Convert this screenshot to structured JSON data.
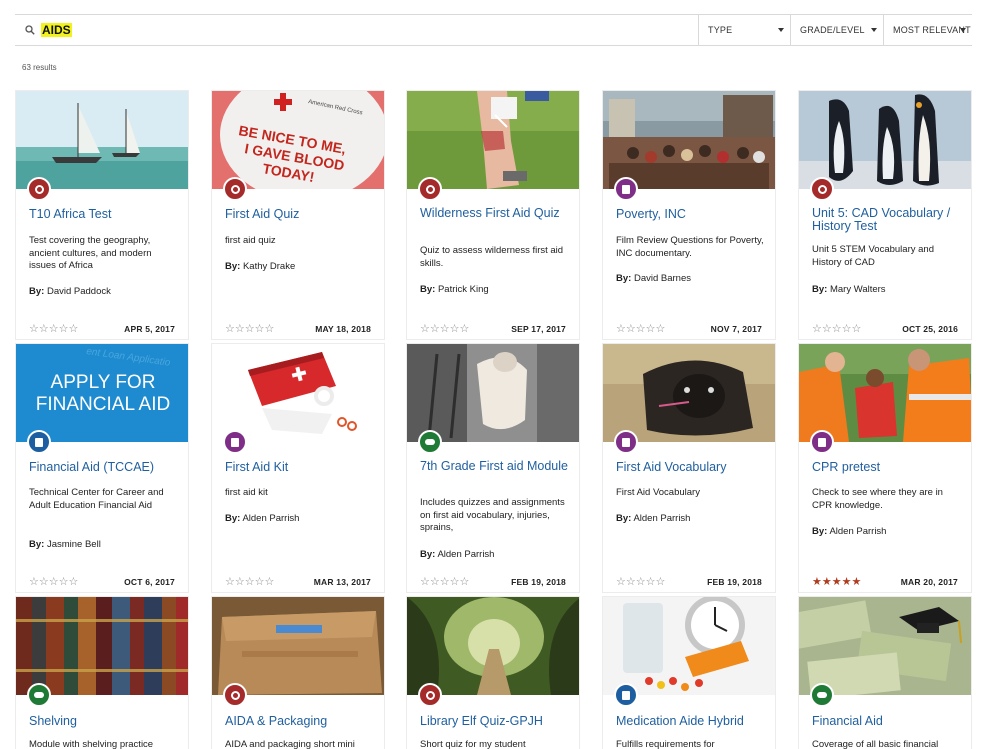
{
  "search": {
    "query": "AIDS"
  },
  "filters": {
    "type": "TYPE",
    "grade": "GRADE/LEVEL",
    "sort": "MOST RELEVANT"
  },
  "results_count": "63 results",
  "colors": {
    "quiz": "#a52a2a",
    "document": "#7e2e86",
    "study": "#1e7a34",
    "blue": "#1c5e9f",
    "link": "#1f5f9f",
    "star_filled": "#b03b1f"
  },
  "cards": [
    {
      "title": "T10 Africa Test",
      "description": "Test covering the geography, ancient cultures, and modern issues of Africa",
      "by_label": "By:",
      "author": "David Paddock",
      "date": "APR 5, 2017",
      "badge": "quiz",
      "image": "sailboats"
    },
    {
      "title": "First Aid Quiz",
      "description": "first aid quiz",
      "by_label": "By:",
      "author": "Kathy Drake",
      "date": "MAY 18, 2018",
      "badge": "quiz",
      "image": "blood-sticker",
      "image_text": "BE NICE TO ME, I GAVE BLOOD TODAY!",
      "image_brand": "American Red Cross"
    },
    {
      "title": "Wilderness First Aid Quiz",
      "description": "Quiz to assess wilderness first aid skills.",
      "by_label": "By:",
      "author": "Patrick King",
      "date": "SEP 17, 2017",
      "badge": "quiz",
      "image": "bandaged-leg"
    },
    {
      "title": "Poverty, INC",
      "description": "Film Review Questions for Poverty, INC documentary.",
      "by_label": "By:",
      "author": "David Barnes",
      "date": "NOV 7, 2017",
      "badge": "document",
      "image": "crowd"
    },
    {
      "title": "Unit 5: CAD Vocabulary / History Test",
      "description": "Unit 5 STEM Vocabulary and History of CAD",
      "by_label": "By:",
      "author": "Mary Walters",
      "date": "OCT 25, 2016",
      "badge": "quiz",
      "image": "penguins"
    },
    {
      "title": "Financial Aid (TCCAE)",
      "description": "Technical Center for Career and Adult Education Financial Aid",
      "by_label": "By:",
      "author": "Jasmine Bell",
      "date": "OCT 6, 2017",
      "badge": "blue",
      "image": "apply-aid",
      "image_text": "APPLY FOR FINANCIAL AID",
      "image_bg_text": "ent Loan Applicatio"
    },
    {
      "title": "First Aid Kit",
      "description": "first aid kit",
      "by_label": "By:",
      "author": "Alden Parrish",
      "date": "MAR 13, 2017",
      "badge": "document",
      "image": "first-aid-kit"
    },
    {
      "title": "7th Grade First aid Module",
      "description": "Includes quizzes and assignments on first aid vocabulary, injuries, sprains,",
      "by_label": "By:",
      "author": "Alden Parrish",
      "date": "FEB 19, 2018",
      "badge": "study",
      "image": "bandaged-foot"
    },
    {
      "title": "First Aid Vocabulary",
      "description": "First Aid Vocabulary",
      "by_label": "By:",
      "author": "Alden Parrish",
      "date": "FEB 19, 2018",
      "badge": "document",
      "image": "pug"
    },
    {
      "title": "CPR pretest",
      "description": "Check to see where they are in CPR knowledge.",
      "by_label": "By:",
      "author": "Alden Parrish",
      "date": "MAR 20, 2017",
      "badge": "document",
      "image": "cpr",
      "rating": 5
    },
    {
      "title": "Shelving",
      "description": "Module with shelving practice",
      "badge": "study",
      "image": "books"
    },
    {
      "title": "AIDA & Packaging",
      "description": "AIDA and packaging short mini",
      "badge": "quiz",
      "image": "box"
    },
    {
      "title": "Library Elf Quiz-GPJH",
      "description": "Short quiz for my student",
      "badge": "quiz",
      "image": "tree-tunnel"
    },
    {
      "title": "Medication Aide Hybrid",
      "description": "Fulfills requirements for",
      "badge": "blue",
      "image": "pills"
    },
    {
      "title": "Financial Aid",
      "description": "Coverage of all basic financial",
      "badge": "study",
      "image": "money"
    }
  ]
}
